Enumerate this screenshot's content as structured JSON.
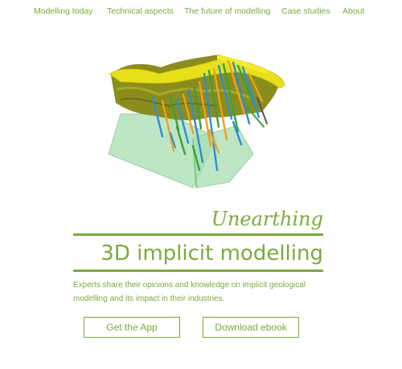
{
  "nav": {
    "items": [
      {
        "label": "Modelling today"
      },
      {
        "label": "Technical aspects"
      },
      {
        "label": "The future of modelling"
      },
      {
        "label": "Case studies"
      },
      {
        "label": "About"
      }
    ]
  },
  "hero": {
    "kicker": "Unearthing",
    "title": "3D implicit modelling",
    "description": "Experts share their opinions and knowledge on implicit geological modelling and its impact in their industries."
  },
  "buttons": {
    "app_label": "Get the App",
    "ebook_label": "Download ebook"
  },
  "colors": {
    "accent": "#7aab3a",
    "surface_yellow": "#e8e01a",
    "surface_olive": "#8a8d1c",
    "plane_green": "#a8dcb0",
    "drill_blue": "#2a8fd6",
    "drill_orange": "#f0a020",
    "drill_green": "#3aa040"
  }
}
